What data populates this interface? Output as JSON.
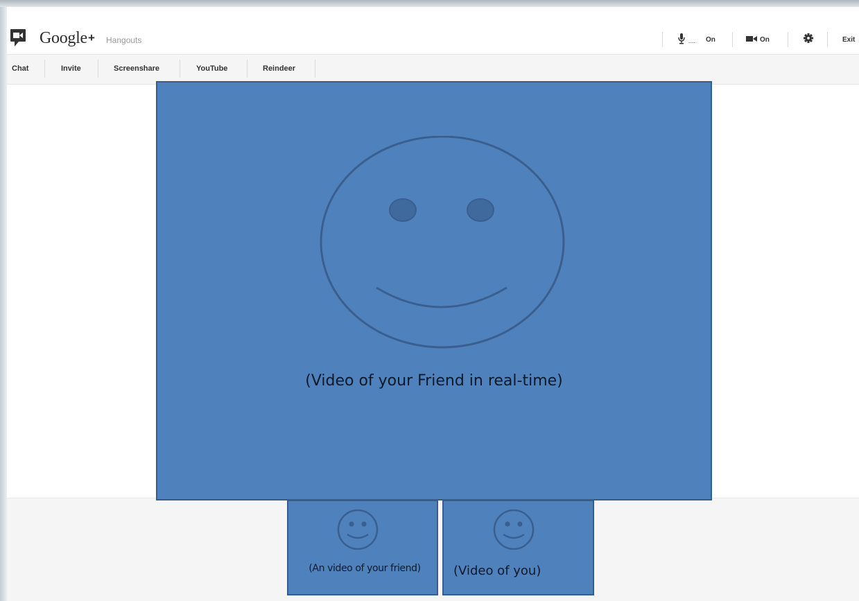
{
  "app": {
    "brand": "Google",
    "brand_plus": "+",
    "product": "Hangouts"
  },
  "header": {
    "mic_icon": "microphone-icon",
    "mic_level": "....",
    "mic_status": "On",
    "camera_icon": "video-camera-icon",
    "camera_status": "On",
    "settings_icon": "gear-icon",
    "exit_label": "Exit"
  },
  "toolbar": {
    "items": [
      "Chat",
      "Invite",
      "Screenshare",
      "YouTube",
      "Reindeer"
    ]
  },
  "main_video": {
    "caption": "(Video of your Friend in real-time)"
  },
  "thumbnails": [
    {
      "caption": "(An video of your friend)"
    },
    {
      "caption": "(Video of you)"
    }
  ],
  "colors": {
    "video_fill": "#4f81bd",
    "video_border": "#385d8a",
    "toolbar_bg": "#f5f5f5"
  }
}
